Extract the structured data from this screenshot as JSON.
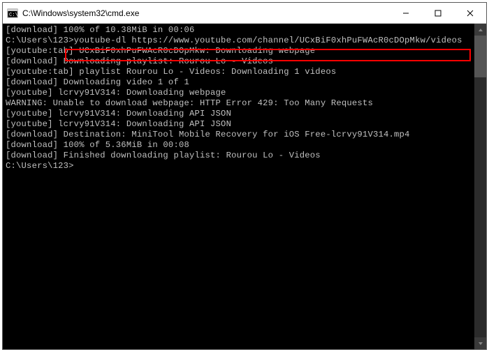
{
  "window": {
    "title": "C:\\Windows\\system32\\cmd.exe"
  },
  "terminal": {
    "lines": [
      "[download] 100% of 10.38MiB in 00:06",
      "",
      "C:\\Users\\123>youtube-dl https://www.youtube.com/channel/UCxBiF0xhPuFWAcR0cDOpMkw/videos",
      "",
      "[youtube:tab] UCxBiF0xhPuFWAcR0cDOpMkw: Downloading webpage",
      "[download] Downloading playlist: Rourou Lo - Videos",
      "[youtube:tab] playlist Rourou Lo - Videos: Downloading 1 videos",
      "[download] Downloading video 1 of 1",
      "[youtube] lcrvy91V314: Downloading webpage",
      "WARNING: Unable to download webpage: HTTP Error 429: Too Many Requests",
      "[youtube] lcrvy91V314: Downloading API JSON",
      "[youtube] lcrvy91V314: Downloading API JSON",
      "[download] Destination: MiniTool Mobile Recovery for iOS Free-lcrvy91V314.mp4",
      "[download] 100% of 5.36MiB in 00:08",
      "[download] Finished downloading playlist: Rourou Lo - Videos",
      "",
      "C:\\Users\\123>"
    ]
  }
}
